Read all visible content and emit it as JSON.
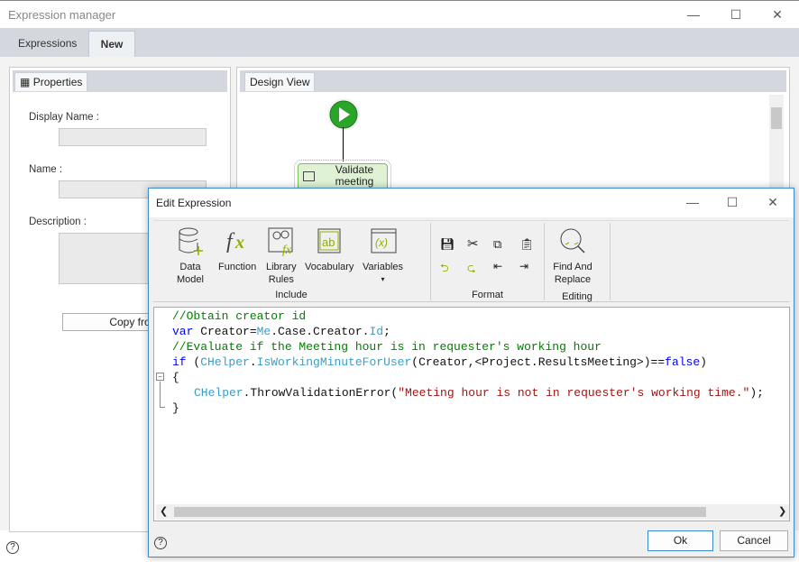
{
  "window": {
    "title": "Expression manager",
    "minimize_icon": "minimize-icon",
    "maximize_icon": "maximize-icon",
    "close_icon": "close-icon"
  },
  "tabs": [
    {
      "label": "Expressions"
    },
    {
      "label": "New",
      "active": true
    }
  ],
  "properties": {
    "tab": "Properties",
    "display_name_label": "Display Name :",
    "name_label": "Name :",
    "description_label": "Description :",
    "copy_button": "Copy from"
  },
  "design_view": {
    "tab": "Design View",
    "task_label": "Validate meeting"
  },
  "dialog": {
    "title": "Edit Expression",
    "ribbon": {
      "include": {
        "label": "Include",
        "buttons": [
          {
            "label1": "Data",
            "label2": "Model"
          },
          {
            "label1": "Function",
            "label2": ""
          },
          {
            "label1": "Library",
            "label2": "Rules"
          },
          {
            "label1": "Vocabulary",
            "label2": ""
          },
          {
            "label1": "Variables",
            "label2": "▾"
          }
        ]
      },
      "format": {
        "label": "Format",
        "icons": [
          "save-icon",
          "cut-icon",
          "copy-icon",
          "paste-icon",
          "undo-icon",
          "redo-icon",
          "outdent-icon",
          "indent-icon"
        ]
      },
      "editing": {
        "label": "Editing",
        "button1": "Find And",
        "button2": "Replace"
      }
    },
    "code": {
      "l1": "//Obtain creator id",
      "l2a": "var",
      "l2b": " Creator=",
      "l2c": "Me",
      "l2d": ".Case.Creator.",
      "l2e": "Id",
      "l2f": ";",
      "l3": "//Evaluate if the Meeting hour is in requester's working hour",
      "l4a": "if",
      "l4b": " (",
      "l4c": "CHelper",
      "l4d": ".",
      "l4e": "IsWorkingMinuteForUser",
      "l4f": "(Creator,<Project.ResultsMeeting>)==",
      "l4g": "false",
      "l4h": ")",
      "l5": "{",
      "l6a": "CHelper",
      "l6b": ".ThrowValidationError(",
      "l6c": "\"Meeting hour is not in requester's working time.\"",
      "l6d": ");",
      "l7": "}"
    },
    "ok": "Ok",
    "cancel": "Cancel"
  },
  "colors": {
    "comment": "#008000",
    "keyword": "#0000ff",
    "type": "#3a9ec8",
    "string": "#a31515",
    "accent": "#3c8ad0"
  }
}
